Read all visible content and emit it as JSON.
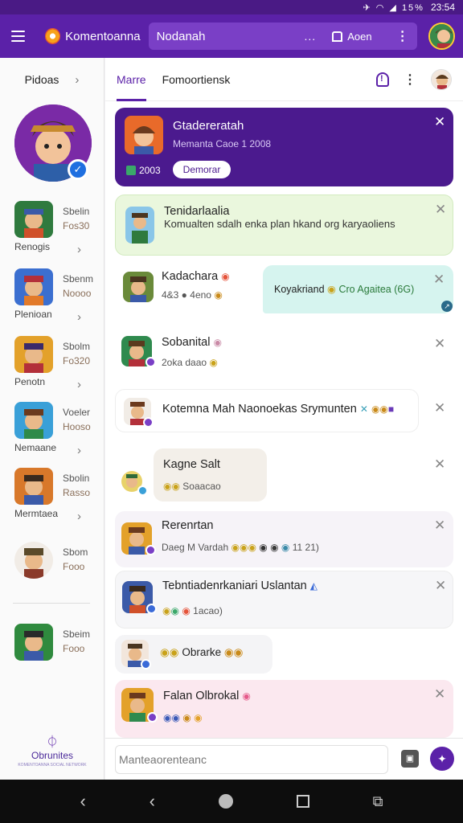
{
  "status_bar": {
    "icons": "✈ ◠ ◢ 15%",
    "time": "23:54"
  },
  "app_bar": {
    "brand_name": "Komentoanna",
    "search_value": "Nodanah",
    "search_more": "...",
    "open_label": "Aoen",
    "colors": {
      "primary": "#5b21a8",
      "status": "#4a1a85"
    }
  },
  "sidebar": {
    "header_label": "Pidoas",
    "items": [
      {
        "meta1": "Sbelin",
        "meta2": "Fos30",
        "caption": "Renogis"
      },
      {
        "meta1": "Sbenm",
        "meta2": "Noooo",
        "caption": "Plenioan"
      },
      {
        "meta1": "Sbolm",
        "meta2": "Fo320",
        "caption": "Penotn"
      },
      {
        "meta1": "Voeler",
        "meta2": "Hooso",
        "caption": "Nemaane"
      },
      {
        "meta1": "Sbolin",
        "meta2": "Rasso",
        "caption": "Mermtaea"
      },
      {
        "meta1": "Sbom",
        "meta2": "Fooo",
        "caption": ""
      },
      {
        "meta1": "Sbeim",
        "meta2": "Fooo",
        "caption": ""
      }
    ],
    "brand_label": "Obrunites",
    "brand_tagline": "KOMENTOANNA SOCIAL NETWORK"
  },
  "tabs": [
    {
      "label": "Marre"
    },
    {
      "label": "Fomoortiensk"
    }
  ],
  "feed": {
    "hero": {
      "title": "Gtadereratah",
      "subtitle": "Memanta Caoe 1 2008",
      "count": "2003",
      "button": "Demorar"
    },
    "tip": {
      "title": "Tenidarlaalia",
      "text": "Komualten sdalh enka plan hkand org karyaoliens"
    },
    "item1": {
      "name": "Kadachara",
      "sub": "4&3 ● 4eno"
    },
    "bubble1": {
      "text": "Koyakriand",
      "tail": "Cro Agaitea (6G)"
    },
    "item2": {
      "name": "Sobanital",
      "sub": "2oka daao"
    },
    "item3": {
      "name": "Kotemna Mah Naonoekas Srymunten"
    },
    "item4": {
      "name": "Kagne Salt",
      "sub": "Soaacao"
    },
    "item5": {
      "name": "Rerenrtan",
      "sub": "Daeg M Vardah",
      "sub_tail": "11 21)"
    },
    "item6": {
      "name": "Tebntiadenrkaniari Uslantan",
      "sub": "1acao)"
    },
    "item7": {
      "name": "Obrarke"
    },
    "item8": {
      "name": "Falan Olbrokal"
    }
  },
  "composer": {
    "placeholder": "Manteaorenteanc"
  }
}
